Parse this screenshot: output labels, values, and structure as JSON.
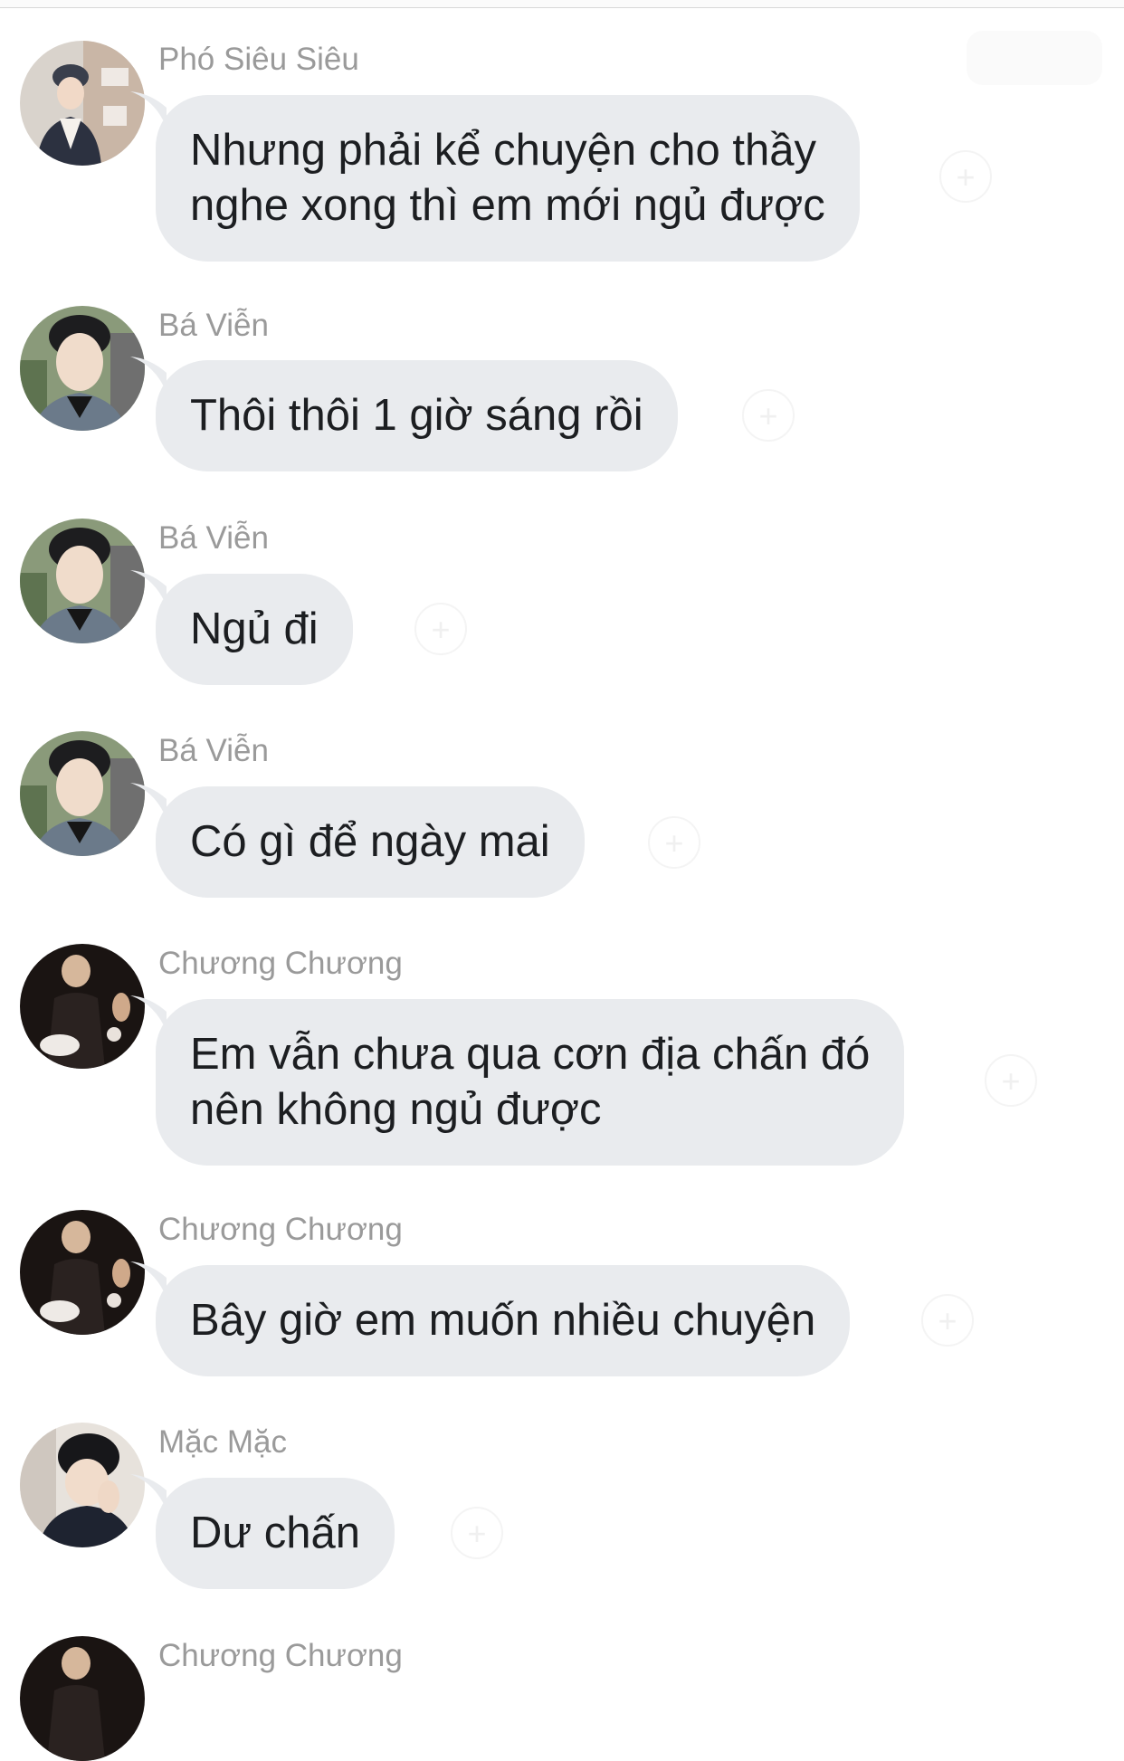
{
  "messages": [
    {
      "sender": "Phó Siêu Siêu",
      "lines": [
        "Nhưng phải kể chuyện cho thầy",
        "nghe xong thì em mới ngủ được"
      ],
      "avatar_icon": "avatar-photo-pho-sieu-sieu"
    },
    {
      "sender": "Bá Viễn",
      "lines": [
        "Thôi thôi 1 giờ sáng rồi"
      ],
      "avatar_icon": "avatar-photo-ba-vien"
    },
    {
      "sender": "Bá Viễn",
      "lines": [
        "Ngủ đi"
      ],
      "avatar_icon": "avatar-photo-ba-vien"
    },
    {
      "sender": "Bá Viễn",
      "lines": [
        "Có gì để ngày mai"
      ],
      "avatar_icon": "avatar-photo-ba-vien"
    },
    {
      "sender": "Chương Chương",
      "lines": [
        "Em vẫn chưa qua cơn địa chấn đó",
        "nên không ngủ được"
      ],
      "avatar_icon": "avatar-photo-chuong-chuong"
    },
    {
      "sender": "Chương Chương",
      "lines": [
        "Bây giờ em muốn nhiều chuyện"
      ],
      "avatar_icon": "avatar-photo-chuong-chuong"
    },
    {
      "sender": "Mặc Mặc",
      "lines": [
        "Dư chấn"
      ],
      "avatar_icon": "avatar-photo-mac-mac"
    },
    {
      "sender": "Chương Chương",
      "lines": [],
      "avatar_icon": "avatar-photo-chuong-chuong"
    }
  ],
  "reaction_button": {
    "icon": "add-reaction-icon",
    "glyph": "+"
  },
  "colors": {
    "background": "#ffffff",
    "bubble": "#e9ebee",
    "message_text": "#1c1e21",
    "sender_name": "#9a9a9a"
  }
}
